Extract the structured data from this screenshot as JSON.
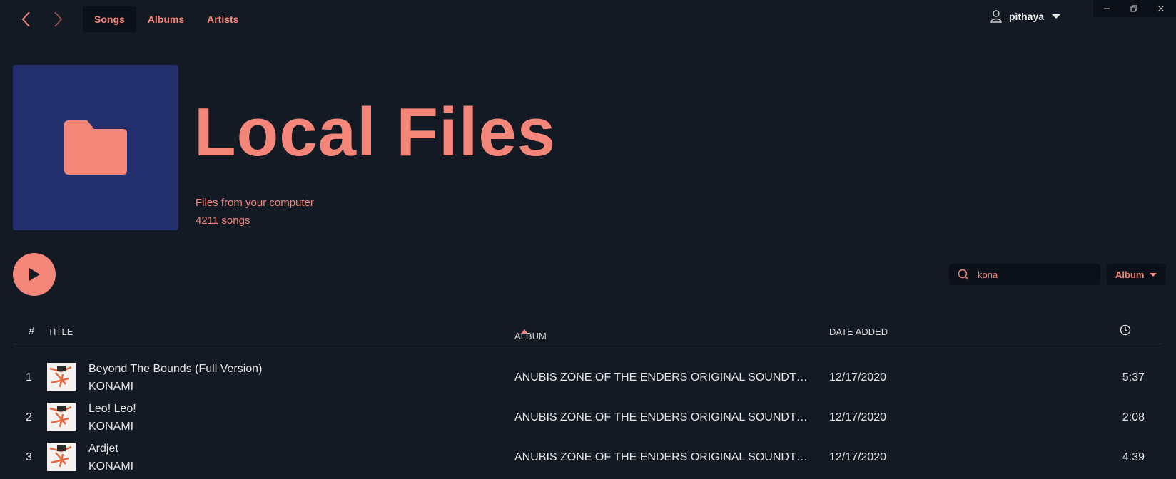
{
  "nav": {
    "tabs": [
      "Songs",
      "Albums",
      "Artists"
    ]
  },
  "user": {
    "name": "pĩthaya"
  },
  "header": {
    "title": "Local Files",
    "subtitle": "Files from your computer",
    "song_count": "4211 songs"
  },
  "search": {
    "value": "kona"
  },
  "sort": {
    "label": "Album"
  },
  "table": {
    "headers": {
      "num": "#",
      "title": "TITLE",
      "album": "ALBUM",
      "date": "DATE ADDED"
    },
    "rows": [
      {
        "num": "1",
        "title": "Beyond The Bounds (Full Version)",
        "artist": "KONAMI",
        "album": "ANUBIS ZONE OF THE ENDERS ORIGINAL SOUNDTRACK",
        "date": "12/17/2020",
        "duration": "5:37"
      },
      {
        "num": "2",
        "title": "Leo! Leo!",
        "artist": "KONAMI",
        "album": "ANUBIS ZONE OF THE ENDERS ORIGINAL SOUNDTRACK",
        "date": "12/17/2020",
        "duration": "2:08"
      },
      {
        "num": "3",
        "title": "Ardjet",
        "artist": "KONAMI",
        "album": "ANUBIS ZONE OF THE ENDERS ORIGINAL SOUNDTRACK",
        "date": "12/17/2020",
        "duration": "4:39"
      }
    ]
  },
  "colors": {
    "accent": "#f48679",
    "background": "#141a24",
    "cover": "#24306e"
  }
}
